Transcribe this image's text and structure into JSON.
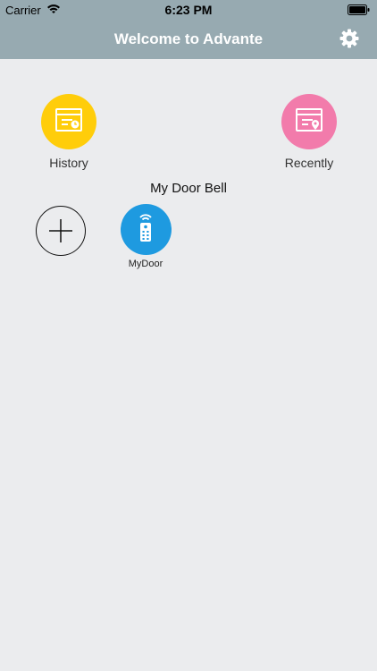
{
  "status_bar": {
    "carrier": "Carrier",
    "time": "6:23 PM",
    "icons": [
      "wifi-icon",
      "battery-icon"
    ]
  },
  "nav": {
    "title": "Welcome to Advante",
    "settings_icon": "gear-icon"
  },
  "shortcuts": {
    "history": {
      "label": "History",
      "icon": "calendar-clock-icon",
      "color": "#ffcd0a"
    },
    "recently": {
      "label": "Recently",
      "icon": "calendar-pin-icon",
      "color": "#f27bab"
    }
  },
  "section": {
    "title": "My Door Bell"
  },
  "devices": {
    "add_icon": "plus-icon",
    "items": [
      {
        "label": "MyDoor",
        "icon": "remote-control-icon",
        "color": "#1e9ae0"
      }
    ]
  },
  "colors": {
    "header": "#97aab1",
    "background": "#ebecee"
  }
}
